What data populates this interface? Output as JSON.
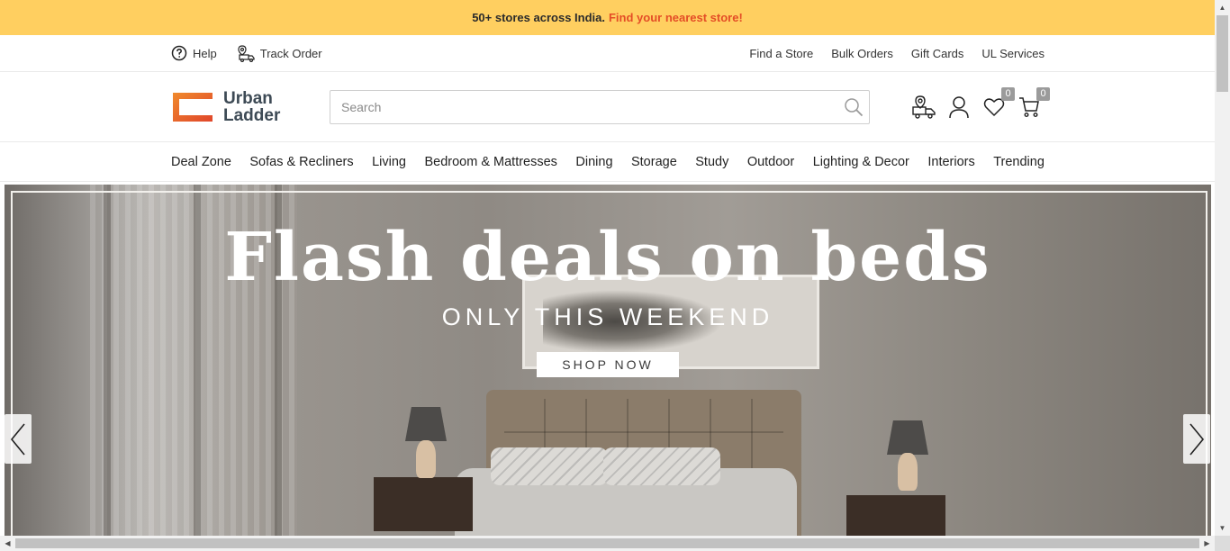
{
  "promo": {
    "text": "50+ stores across India.",
    "link": "Find your nearest store!"
  },
  "utility": {
    "help": "Help",
    "track_order": "Track Order",
    "links": [
      "Find a Store",
      "Bulk Orders",
      "Gift Cards",
      "UL Services"
    ]
  },
  "header": {
    "logo_line1": "Urban",
    "logo_line2": "Ladder",
    "search_placeholder": "Search",
    "wishlist_count": "0",
    "cart_count": "0"
  },
  "nav": {
    "items": [
      "Deal Zone",
      "Sofas & Recliners",
      "Living",
      "Bedroom & Mattresses",
      "Dining",
      "Storage",
      "Study",
      "Outdoor",
      "Lighting & Decor",
      "Interiors",
      "Trending"
    ]
  },
  "hero": {
    "title": "Flash deals on beds",
    "subtitle": "ONLY THIS WEEKEND",
    "cta": "SHOP NOW"
  },
  "colors": {
    "promo_bg": "#ffcf60",
    "promo_link": "#e44d26",
    "logo_orange": "#e8702a",
    "badge": "#9b9b9b"
  },
  "icons": [
    "help-icon",
    "track-order-icon",
    "search-icon",
    "store-locator-icon",
    "user-icon",
    "heart-icon",
    "cart-icon",
    "chevron-left-icon",
    "chevron-right-icon"
  ]
}
